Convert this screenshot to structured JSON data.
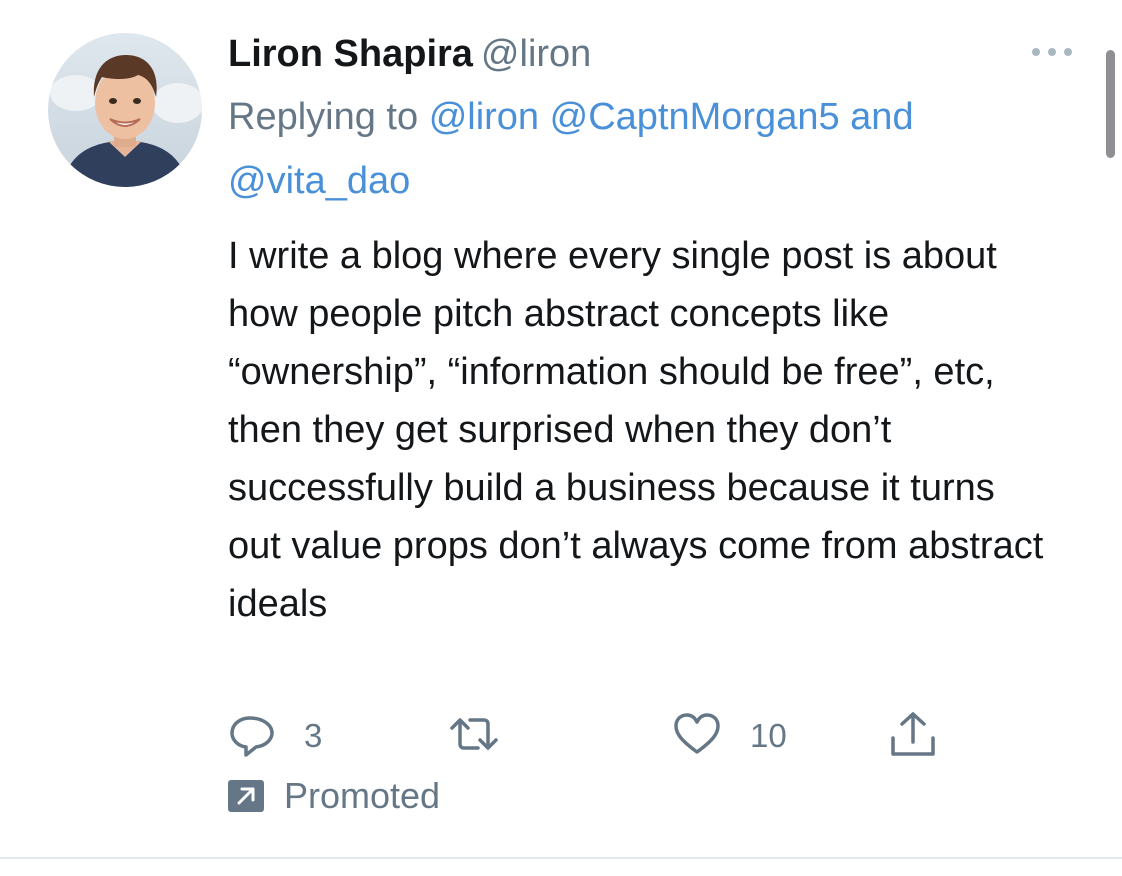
{
  "tweet": {
    "display_name": "Liron Shapira",
    "handle": "@liron",
    "reply_prefix": "Replying to",
    "reply_mentions": [
      "@liron",
      "@CaptnMorgan5"
    ],
    "reply_and": "and",
    "reply_last_mention": "@vita_dao",
    "text": "I write a blog where every single post is about how people pitch abstract concepts like “ownership”, “information should be free”, etc, then they get surprised when they don’t successfully build a business because it turns out value props don’t always come from abstract ideals",
    "reply_count": "3",
    "retweet_count": "",
    "like_count": "10",
    "promoted_label": "Promoted"
  },
  "icons": {
    "more": "more-horizontal-icon",
    "reply": "reply-bubble-icon",
    "retweet": "retweet-icon",
    "like": "heart-icon",
    "share": "share-icon",
    "promoted": "promoted-arrow-icon"
  },
  "colors": {
    "text": "#14171a",
    "secondary": "#657786",
    "link": "#4a90d9",
    "divider": "#e1e8ed"
  }
}
